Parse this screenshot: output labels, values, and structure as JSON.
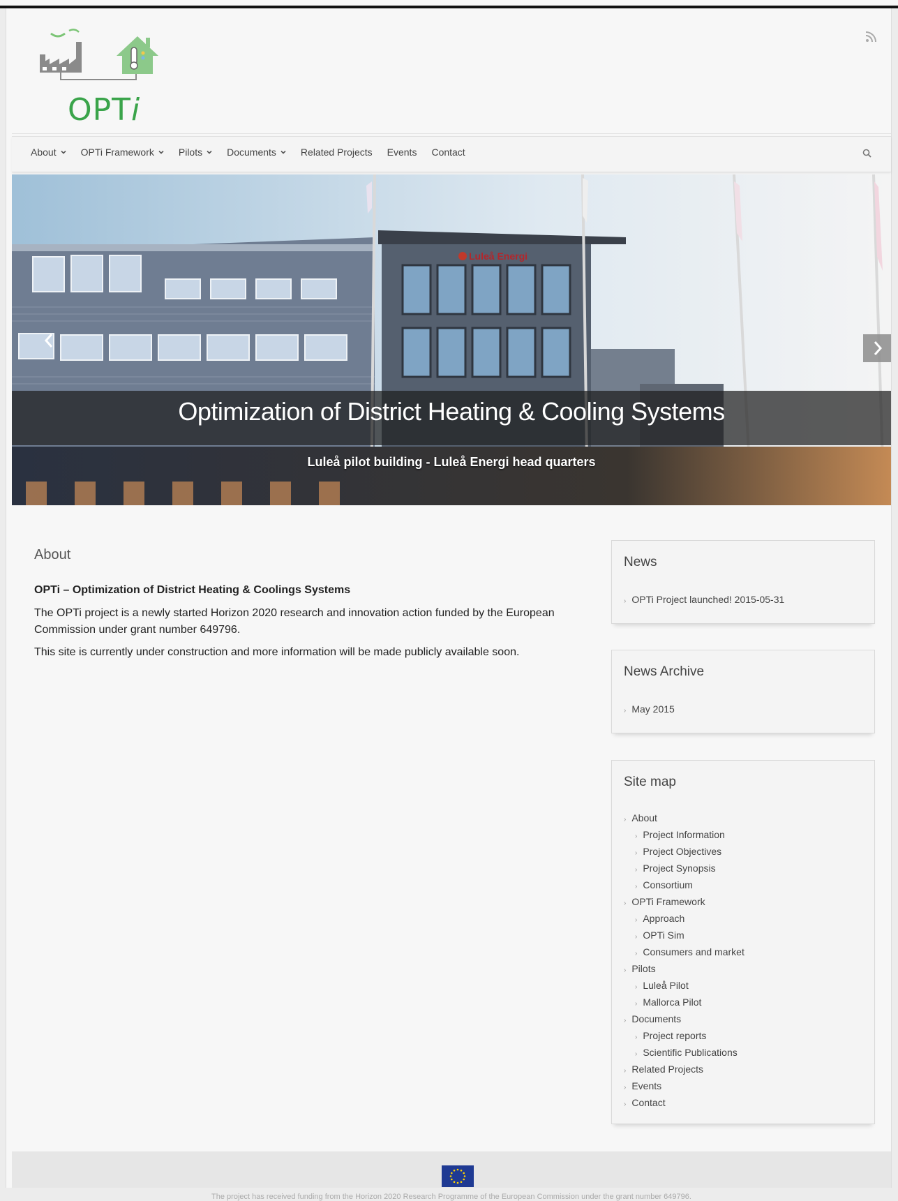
{
  "header": {
    "logo_text_plain": "OPT",
    "logo_text_italic": "i",
    "rss_icon": "rss-icon"
  },
  "nav": {
    "items": [
      {
        "label": "About",
        "dropdown": true
      },
      {
        "label": "OPTi Framework",
        "dropdown": true
      },
      {
        "label": "Pilots",
        "dropdown": true
      },
      {
        "label": "Documents",
        "dropdown": true
      },
      {
        "label": "Related Projects",
        "dropdown": false
      },
      {
        "label": "Events",
        "dropdown": false
      },
      {
        "label": "Contact",
        "dropdown": false
      }
    ],
    "search_icon": "search-icon"
  },
  "slider": {
    "title": "Optimization of District Heating & Cooling Systems",
    "subtitle": "Luleå pilot building - Luleå Energi head quarters",
    "building_sign": "Luleå Energi",
    "prev_icon": "chevron-left-icon",
    "next_icon": "chevron-right-icon"
  },
  "main": {
    "heading": "About",
    "subheading": "OPTi – Optimization of District Heating & Coolings Systems",
    "paragraphs": [
      "The OPTi project is a newly started Horizon 2020 research and innovation action funded by the European Commission under grant number 649796.",
      "This site is currently under construction and more information will be made publicly available soon."
    ]
  },
  "sidebar": {
    "news": {
      "title": "News",
      "items": [
        "OPTi Project launched! 2015-05-31"
      ]
    },
    "archive": {
      "title": "News Archive",
      "items": [
        "May 2015"
      ]
    },
    "sitemap": {
      "title": "Site map",
      "items": [
        {
          "label": "About",
          "level": 0
        },
        {
          "label": "Project Information",
          "level": 1
        },
        {
          "label": "Project Objectives",
          "level": 1
        },
        {
          "label": "Project Synopsis",
          "level": 1
        },
        {
          "label": "Consortium",
          "level": 1
        },
        {
          "label": "OPTi Framework",
          "level": 0
        },
        {
          "label": "Approach",
          "level": 1
        },
        {
          "label": "OPTi Sim",
          "level": 1
        },
        {
          "label": "Consumers and market",
          "level": 1
        },
        {
          "label": "Pilots",
          "level": 0
        },
        {
          "label": "Luleå Pilot",
          "level": 1
        },
        {
          "label": "Mallorca Pilot",
          "level": 1
        },
        {
          "label": "Documents",
          "level": 0
        },
        {
          "label": "Project reports",
          "level": 1
        },
        {
          "label": "Scientific Publications",
          "level": 1
        },
        {
          "label": "Related Projects",
          "level": 0
        },
        {
          "label": "Events",
          "level": 0
        },
        {
          "label": "Contact",
          "level": 0
        }
      ]
    }
  },
  "footer": {
    "flag_icon": "eu-flag-icon",
    "text": "The project has received funding from the Horizon 2020 Research Programme of the European Commission under the grant number 649796."
  },
  "colors": {
    "logo_green": "#3aa44a",
    "page_bg": "#f7f7f7",
    "caption_band": "#1e1e1e",
    "eu_blue": "#1f3a93"
  }
}
